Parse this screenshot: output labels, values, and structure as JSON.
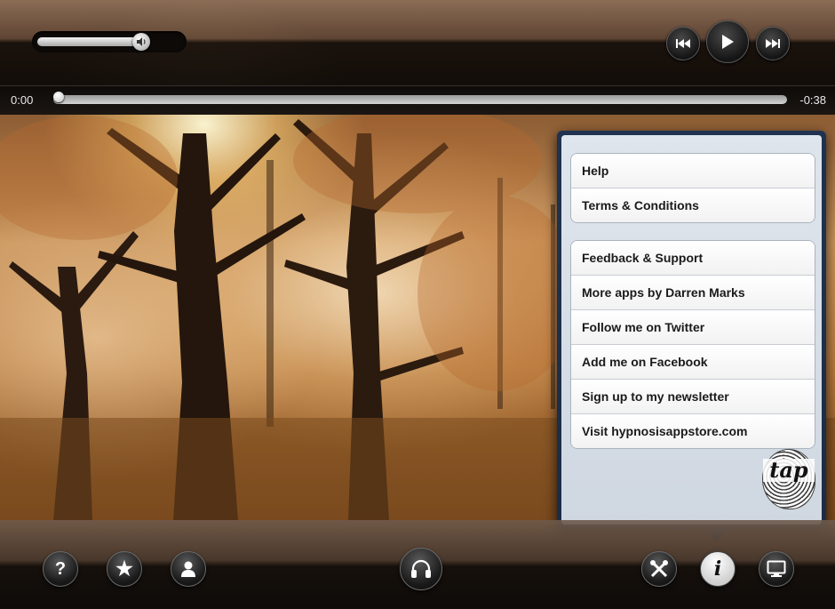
{
  "player": {
    "volume_fraction": 0.75,
    "elapsed": "0:00",
    "remaining": "-0:38",
    "progress_fraction": 0.0
  },
  "transport": {
    "icons": [
      "skip-back-icon",
      "play-icon",
      "skip-forward-icon"
    ]
  },
  "menu": {
    "group1": [
      "Help",
      "Terms & Conditions"
    ],
    "group2": [
      "Feedback & Support",
      "More apps by Darren Marks",
      "Follow me on Twitter",
      "Add me on Facebook",
      "Sign up to my newsletter",
      "Visit hypnosisappstore.com"
    ],
    "logo_text": "tap"
  },
  "bottom_toolbar": {
    "icons": [
      "help-icon",
      "favorites-star-icon",
      "profile-icon",
      "headphones-icon",
      "settings-tools-icon",
      "info-icon",
      "display-icon"
    ]
  },
  "colors": {
    "popover_border": "#1b2c46",
    "popover_bg": "#dfe5ec",
    "bar_dark": "#0e0b09"
  }
}
